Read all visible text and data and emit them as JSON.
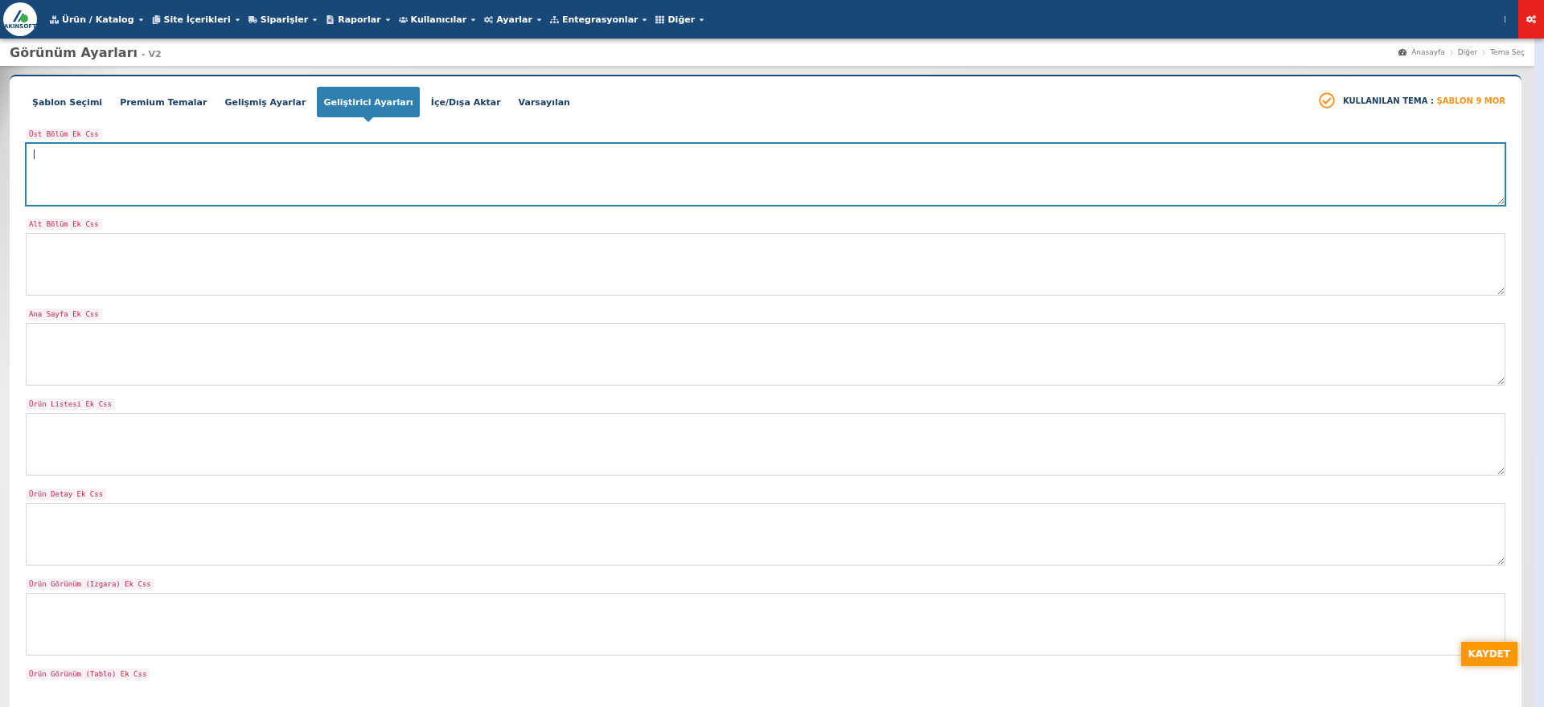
{
  "navbar": {
    "logo": "AKINSOFT",
    "menu": [
      {
        "label": "Ürün / Katalog"
      },
      {
        "label": "Site İçerikleri"
      },
      {
        "label": "Siparişler"
      },
      {
        "label": "Raporlar"
      },
      {
        "label": "Kullanıcılar"
      },
      {
        "label": "Ayarlar"
      },
      {
        "label": "Entegrasyonlar"
      },
      {
        "label": "Diğer"
      }
    ]
  },
  "page_header": {
    "title": "Görünüm Ayarları",
    "version": "- V2",
    "breadcrumb": [
      "Anasayfa",
      "Diğer",
      "Tema Seç"
    ]
  },
  "tabs": [
    {
      "label": "Şablon Seçimi",
      "selected": false
    },
    {
      "label": "Premium Temalar",
      "selected": false
    },
    {
      "label": "Gelişmiş Ayarlar",
      "selected": false
    },
    {
      "label": "Geliştirici Ayarları",
      "selected": true
    },
    {
      "label": "İçe/Dışa Aktar",
      "selected": false
    },
    {
      "label": "Varsayılan",
      "selected": false
    }
  ],
  "active_theme": {
    "label": "KULLANILAN TEMA :",
    "value": "ŞABLON 9 MOR"
  },
  "fields": [
    {
      "label": "Üst Bölüm Ek Css",
      "focused": true
    },
    {
      "label": "Alt Bölüm Ek Css",
      "focused": false
    },
    {
      "label": "Ana Sayfa Ek Css",
      "focused": false
    },
    {
      "label": "Ürün Listesi Ek Css",
      "focused": false
    },
    {
      "label": "Ürün Detay Ek Css",
      "focused": false
    },
    {
      "label": "Ürün Görünüm (Izgara) Ek Css",
      "focused": false
    },
    {
      "label": "Ürün Görünüm (Tablo) Ek Css",
      "focused": false
    }
  ],
  "save_button": "KAYDET"
}
